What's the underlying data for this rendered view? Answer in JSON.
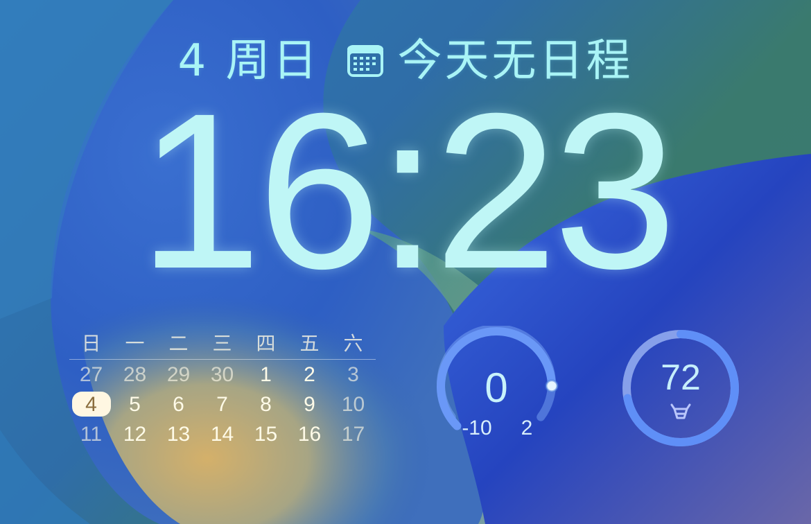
{
  "lock_screen": {
    "date_label": "4 周日",
    "calendar_icon": "calendar-icon",
    "events_label": "今天无日程",
    "time": "16:23"
  },
  "calendar": {
    "weekdays": [
      "日",
      "一",
      "二",
      "三",
      "四",
      "五",
      "六"
    ],
    "weeks": [
      [
        "27",
        "28",
        "29",
        "30",
        "1",
        "2",
        "3"
      ],
      [
        "4",
        "5",
        "6",
        "7",
        "8",
        "9",
        "10"
      ],
      [
        "11",
        "12",
        "13",
        "14",
        "15",
        "16",
        "17"
      ]
    ],
    "today": "4"
  },
  "temperature_widget": {
    "current": "0",
    "low": "-10",
    "high": "2",
    "level_fraction": 0.83
  },
  "score_widget": {
    "value": "72",
    "icon": "bull-head-icon",
    "ring_fraction": 0.72
  },
  "colors": {
    "text_accent": "#a9f4f6",
    "clock": "#bff6f6",
    "calendar_text": "#fffbe6",
    "gauge_blue": "#5f8ff7",
    "gauge_light": "#b5c8fb"
  }
}
